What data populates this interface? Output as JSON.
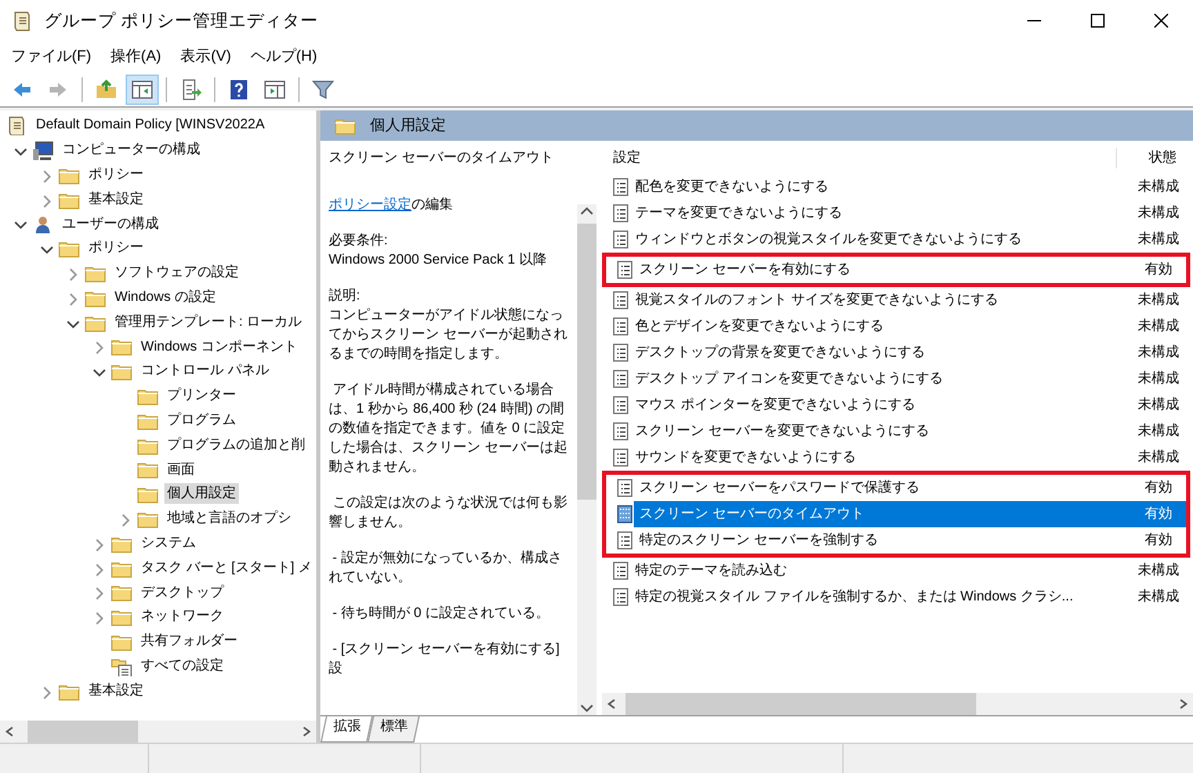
{
  "window": {
    "title": "グループ ポリシー管理エディター"
  },
  "menu": [
    "ファイル(F)",
    "操作(A)",
    "表示(V)",
    "ヘルプ(H)"
  ],
  "toolbar": [
    {
      "kind": "back",
      "disabled": false,
      "pressed": false
    },
    {
      "kind": "forward",
      "disabled": true,
      "pressed": false
    },
    {
      "kind": "sep"
    },
    {
      "kind": "up",
      "disabled": false,
      "pressed": false
    },
    {
      "kind": "tree",
      "disabled": false,
      "pressed": true
    },
    {
      "kind": "sep"
    },
    {
      "kind": "export",
      "disabled": false,
      "pressed": false
    },
    {
      "kind": "sep"
    },
    {
      "kind": "help",
      "disabled": false,
      "pressed": false
    },
    {
      "kind": "pane",
      "disabled": false,
      "pressed": false
    },
    {
      "kind": "sep"
    },
    {
      "kind": "filter",
      "disabled": false,
      "pressed": false
    }
  ],
  "tree": [
    {
      "label": "Default Domain Policy [WINSV2022A",
      "kind": "policy",
      "selected": false,
      "children": [
        {
          "label": "コンピューターの構成",
          "kind": "computer",
          "expanded": true,
          "selected": false,
          "children": [
            {
              "label": "ポリシー",
              "kind": "folder",
              "expanded": false,
              "selected": false
            },
            {
              "label": "基本設定",
              "kind": "folder",
              "expanded": false,
              "selected": false
            }
          ]
        },
        {
          "label": "ユーザーの構成",
          "kind": "user",
          "expanded": true,
          "selected": false,
          "children": [
            {
              "label": "ポリシー",
              "kind": "folder",
              "expanded": true,
              "selected": false,
              "children": [
                {
                  "label": "ソフトウェアの設定",
                  "kind": "folder",
                  "expanded": false,
                  "selected": false
                },
                {
                  "label": "Windows の設定",
                  "kind": "folder",
                  "expanded": false,
                  "selected": false
                },
                {
                  "label": "管理用テンプレート: ローカル",
                  "kind": "folder",
                  "expanded": true,
                  "selected": false,
                  "children": [
                    {
                      "label": "Windows コンポーネント",
                      "kind": "folder",
                      "expanded": false,
                      "selected": false
                    },
                    {
                      "label": "コントロール パネル",
                      "kind": "folder",
                      "expanded": true,
                      "selected": false,
                      "children": [
                        {
                          "label": "プリンター",
                          "kind": "folder",
                          "selected": false
                        },
                        {
                          "label": "プログラム",
                          "kind": "folder",
                          "selected": false
                        },
                        {
                          "label": "プログラムの追加と削",
                          "kind": "folder",
                          "selected": false
                        },
                        {
                          "label": "画面",
                          "kind": "folder",
                          "selected": false
                        },
                        {
                          "label": "個人用設定",
                          "kind": "folder",
                          "selected": true
                        },
                        {
                          "label": "地域と言語のオプシ",
                          "kind": "folder",
                          "expanded": false,
                          "selected": false
                        }
                      ]
                    },
                    {
                      "label": "システム",
                      "kind": "folder",
                      "expanded": false,
                      "selected": false
                    },
                    {
                      "label": "タスク バーと [スタート] メ",
                      "kind": "folder",
                      "expanded": false,
                      "selected": false
                    },
                    {
                      "label": "デスクトップ",
                      "kind": "folder",
                      "expanded": false,
                      "selected": false
                    },
                    {
                      "label": "ネットワーク",
                      "kind": "folder",
                      "expanded": false,
                      "selected": false
                    },
                    {
                      "label": "共有フォルダー",
                      "kind": "folder",
                      "selected": false
                    },
                    {
                      "label": "すべての設定",
                      "kind": "all-settings",
                      "selected": false
                    }
                  ]
                }
              ]
            },
            {
              "label": "基本設定",
              "kind": "folder",
              "expanded": false,
              "selected": false
            }
          ]
        }
      ]
    }
  ],
  "details": {
    "header": "個人用設定",
    "title": "スクリーン セーバーのタイムアウト",
    "edit_link": "ポリシー設定",
    "edit_text": "の編集",
    "paragraphs": [
      "必要条件:\nWindows 2000 Service Pack 1 以降",
      "説明:\nコンピューターがアイドル状態になってからスクリーン セーバーが起動されるまでの時間を指定します。",
      " アイドル時間が構成されている場合は、1 秒から 86,400 秒 (24 時間) の間の数値を指定できます。値を 0 に設定した場合は、スクリーン セーバーは起動されません。",
      " この設定は次のような状況では何も影響しません。",
      " - 設定が無効になっているか、構成されていない。",
      " - 待ち時間が 0 に設定されている。",
      " - [スクリーン セーバーを有効にする] 設"
    ]
  },
  "settings": {
    "columns": [
      "設定",
      "状態"
    ],
    "rows": [
      {
        "name": "配色を変更できないようにする",
        "state": "未構成",
        "selected": false,
        "highlighted": false
      },
      {
        "name": "テーマを変更できないようにする",
        "state": "未構成",
        "selected": false,
        "highlighted": false
      },
      {
        "name": "ウィンドウとボタンの視覚スタイルを変更できないようにする",
        "state": "未構成",
        "selected": false,
        "highlighted": false
      },
      {
        "name": "スクリーン セーバーを有効にする",
        "state": "有効",
        "selected": false,
        "highlighted": true
      },
      {
        "name": "視覚スタイルのフォント サイズを変更できないようにする",
        "state": "未構成",
        "selected": false,
        "highlighted": false
      },
      {
        "name": "色とデザインを変更できないようにする",
        "state": "未構成",
        "selected": false,
        "highlighted": false
      },
      {
        "name": "デスクトップの背景を変更できないようにする",
        "state": "未構成",
        "selected": false,
        "highlighted": false
      },
      {
        "name": "デスクトップ アイコンを変更できないようにする",
        "state": "未構成",
        "selected": false,
        "highlighted": false
      },
      {
        "name": "マウス ポインターを変更できないようにする",
        "state": "未構成",
        "selected": false,
        "highlighted": false
      },
      {
        "name": "スクリーン セーバーを変更できないようにする",
        "state": "未構成",
        "selected": false,
        "highlighted": false
      },
      {
        "name": "サウンドを変更できないようにする",
        "state": "未構成",
        "selected": false,
        "highlighted": false
      },
      {
        "name": "スクリーン セーバーをパスワードで保護する",
        "state": "有効",
        "selected": false,
        "highlighted": true
      },
      {
        "name": "スクリーン セーバーのタイムアウト",
        "state": "有効",
        "selected": true,
        "highlighted": true
      },
      {
        "name": "特定のスクリーン セーバーを強制する",
        "state": "有効",
        "selected": false,
        "highlighted": true
      },
      {
        "name": "特定のテーマを読み込む",
        "state": "未構成",
        "selected": false,
        "highlighted": false
      },
      {
        "name": "特定の視覚スタイル ファイルを強制するか、または Windows クラシ...",
        "state": "未構成",
        "selected": false,
        "highlighted": false
      }
    ]
  },
  "tabs": [
    {
      "label": "拡張",
      "selected": true
    },
    {
      "label": "標準",
      "selected": false
    }
  ]
}
